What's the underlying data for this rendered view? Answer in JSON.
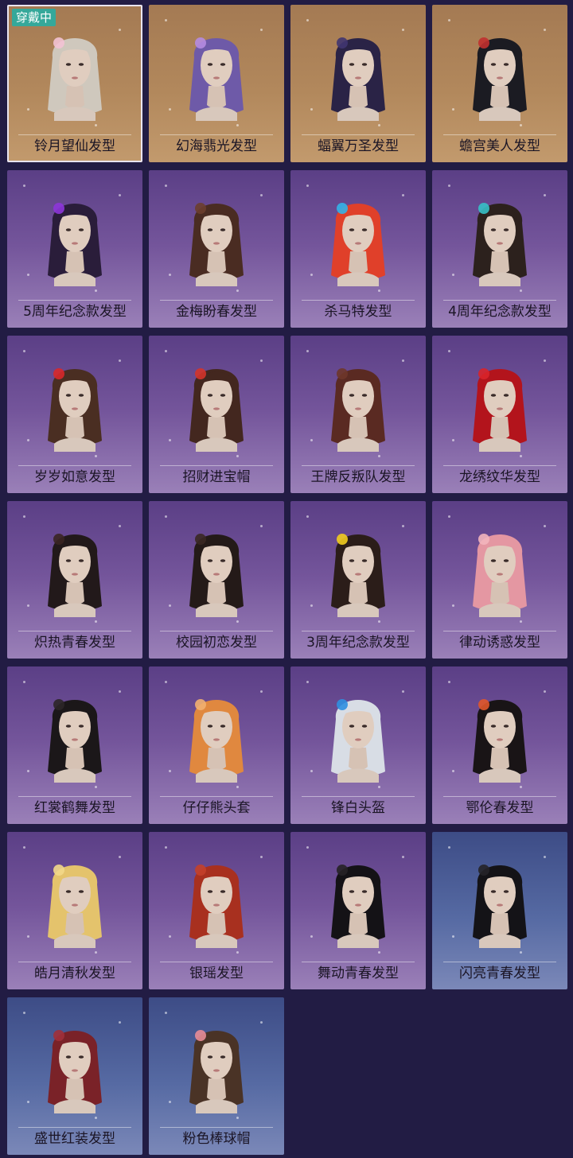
{
  "equipped_badge": "穿戴中",
  "items": [
    {
      "name": "铃月望仙发型",
      "bg": "gold",
      "hair": "#cfc8bd",
      "accent": "#f2c2d4"
    },
    {
      "name": "幻海翡光发型",
      "bg": "gold",
      "hair": "#6e5aa8",
      "accent": "#b58be0"
    },
    {
      "name": "蝠翼万圣发型",
      "bg": "gold",
      "hair": "#2a2346",
      "accent": "#403570"
    },
    {
      "name": "蟾宫美人发型",
      "bg": "gold",
      "hair": "#1b1b22",
      "accent": "#c0302f"
    },
    {
      "name": "5周年纪念款发型",
      "bg": "purple",
      "hair": "#2a1d3a",
      "accent": "#8d35d9"
    },
    {
      "name": "金梅盼春发型",
      "bg": "purple",
      "hair": "#4a2c22",
      "accent": "#6b3e2d"
    },
    {
      "name": "杀马特发型",
      "bg": "purple",
      "hair": "#e0402a",
      "accent": "#34b3e8"
    },
    {
      "name": "4周年纪念款发型",
      "bg": "purple",
      "hair": "#2c211d",
      "accent": "#36c0c7"
    },
    {
      "name": "岁岁如意发型",
      "bg": "purple",
      "hair": "#4a2e22",
      "accent": "#d8282a"
    },
    {
      "name": "招财进宝帽",
      "bg": "purple",
      "hair": "#43271f",
      "accent": "#d4342a"
    },
    {
      "name": "王牌反叛队发型",
      "bg": "purple",
      "hair": "#5a2a22",
      "accent": "#6e362a"
    },
    {
      "name": "龙绣纹华发型",
      "bg": "purple",
      "hair": "#b3141c",
      "accent": "#d8242a"
    },
    {
      "name": "炽热青春发型",
      "bg": "purple",
      "hair": "#22191a",
      "accent": "#3a2522"
    },
    {
      "name": "校园初恋发型",
      "bg": "purple",
      "hair": "#241a18",
      "accent": "#3a2824"
    },
    {
      "name": "3周年纪念款发型",
      "bg": "purple",
      "hair": "#2b1d19",
      "accent": "#f1cc1f"
    },
    {
      "name": "律动诱惑发型",
      "bg": "purple",
      "hair": "#e497a2",
      "accent": "#f2b5bc"
    },
    {
      "name": "红裳鹤舞发型",
      "bg": "purple",
      "hair": "#1b1719",
      "accent": "#2c2628"
    },
    {
      "name": "仔仔熊头套",
      "bg": "purple",
      "hair": "#e0883f",
      "accent": "#f2b070"
    },
    {
      "name": "锋白头盔",
      "bg": "purple",
      "hair": "#d8dde5",
      "accent": "#2f8fe0"
    },
    {
      "name": "鄂伦春发型",
      "bg": "purple",
      "hair": "#191416",
      "accent": "#e0562a"
    },
    {
      "name": "皓月清秋发型",
      "bg": "purple",
      "hair": "#e4c36c",
      "accent": "#f2d88a"
    },
    {
      "name": "银瑶发型",
      "bg": "purple",
      "hair": "#a8301f",
      "accent": "#c3402a"
    },
    {
      "name": "舞动青春发型",
      "bg": "purple",
      "hair": "#141216",
      "accent": "#262226"
    },
    {
      "name": "闪亮青春发型",
      "bg": "blue",
      "hair": "#141317",
      "accent": "#252328"
    },
    {
      "name": "盛世红装发型",
      "bg": "blue",
      "hair": "#7a2228",
      "accent": "#a0303a"
    },
    {
      "name": "粉色棒球帽",
      "bg": "blue",
      "hair": "#4a3326",
      "accent": "#e88c96"
    }
  ]
}
